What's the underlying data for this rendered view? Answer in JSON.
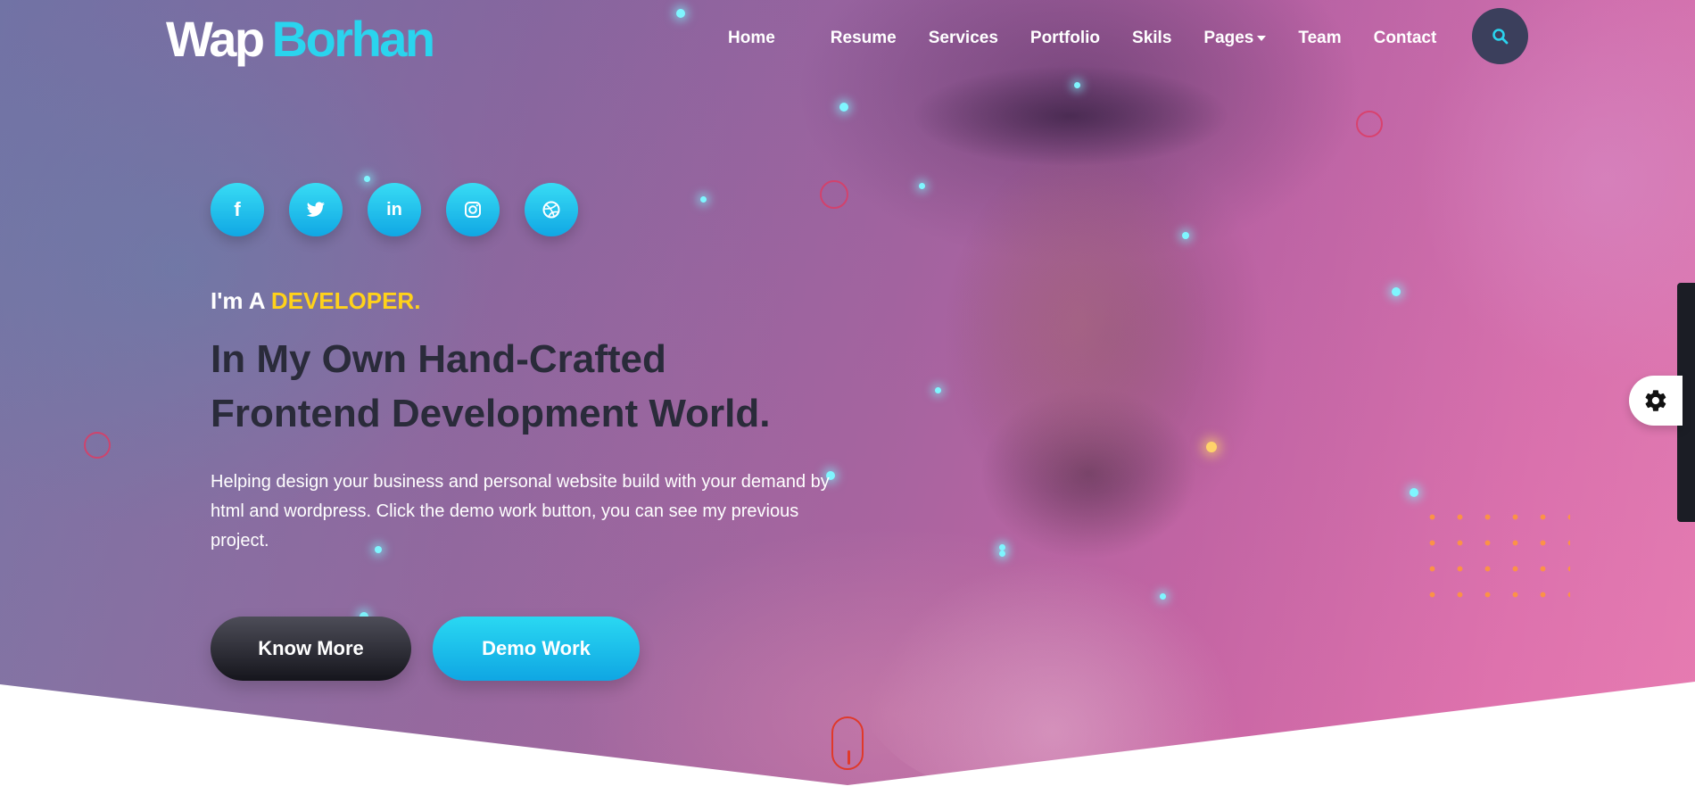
{
  "logo": {
    "part1": "Wap",
    "part2": "Borhan"
  },
  "nav": {
    "items": [
      {
        "label": "Home"
      },
      {
        "label": "Resume"
      },
      {
        "label": "Services"
      },
      {
        "label": "Portfolio"
      },
      {
        "label": "Skils"
      },
      {
        "label": "Pages"
      },
      {
        "label": "Team"
      },
      {
        "label": "Contact"
      }
    ],
    "active": "Home"
  },
  "socials": [
    {
      "icon": "facebook-icon",
      "glyph": "f"
    },
    {
      "icon": "twitter-icon",
      "glyph": ""
    },
    {
      "icon": "linkedin-icon",
      "glyph": "in"
    },
    {
      "icon": "instagram-icon",
      "glyph": ""
    },
    {
      "icon": "dribbble-icon",
      "glyph": ""
    }
  ],
  "hero": {
    "tagline_prefix": "I'm A ",
    "tagline_highlight": "DEVELOPER.",
    "headline_line1": "In My Own Hand-Crafted",
    "headline_line2": "Frontend Development World.",
    "description": "Helping design your business and personal website build with your demand by html and wordpress. Click the demo work button, you can see my previous project.",
    "btn_primary": "Know More",
    "btn_secondary": "Demo Work"
  },
  "colors": {
    "accent_cyan": "#2ad4ee",
    "highlight_yellow": "#ffd21a",
    "headline_dark": "#2a2b3a",
    "button_dark": "#15151c",
    "scroll_red": "#e0392a"
  }
}
